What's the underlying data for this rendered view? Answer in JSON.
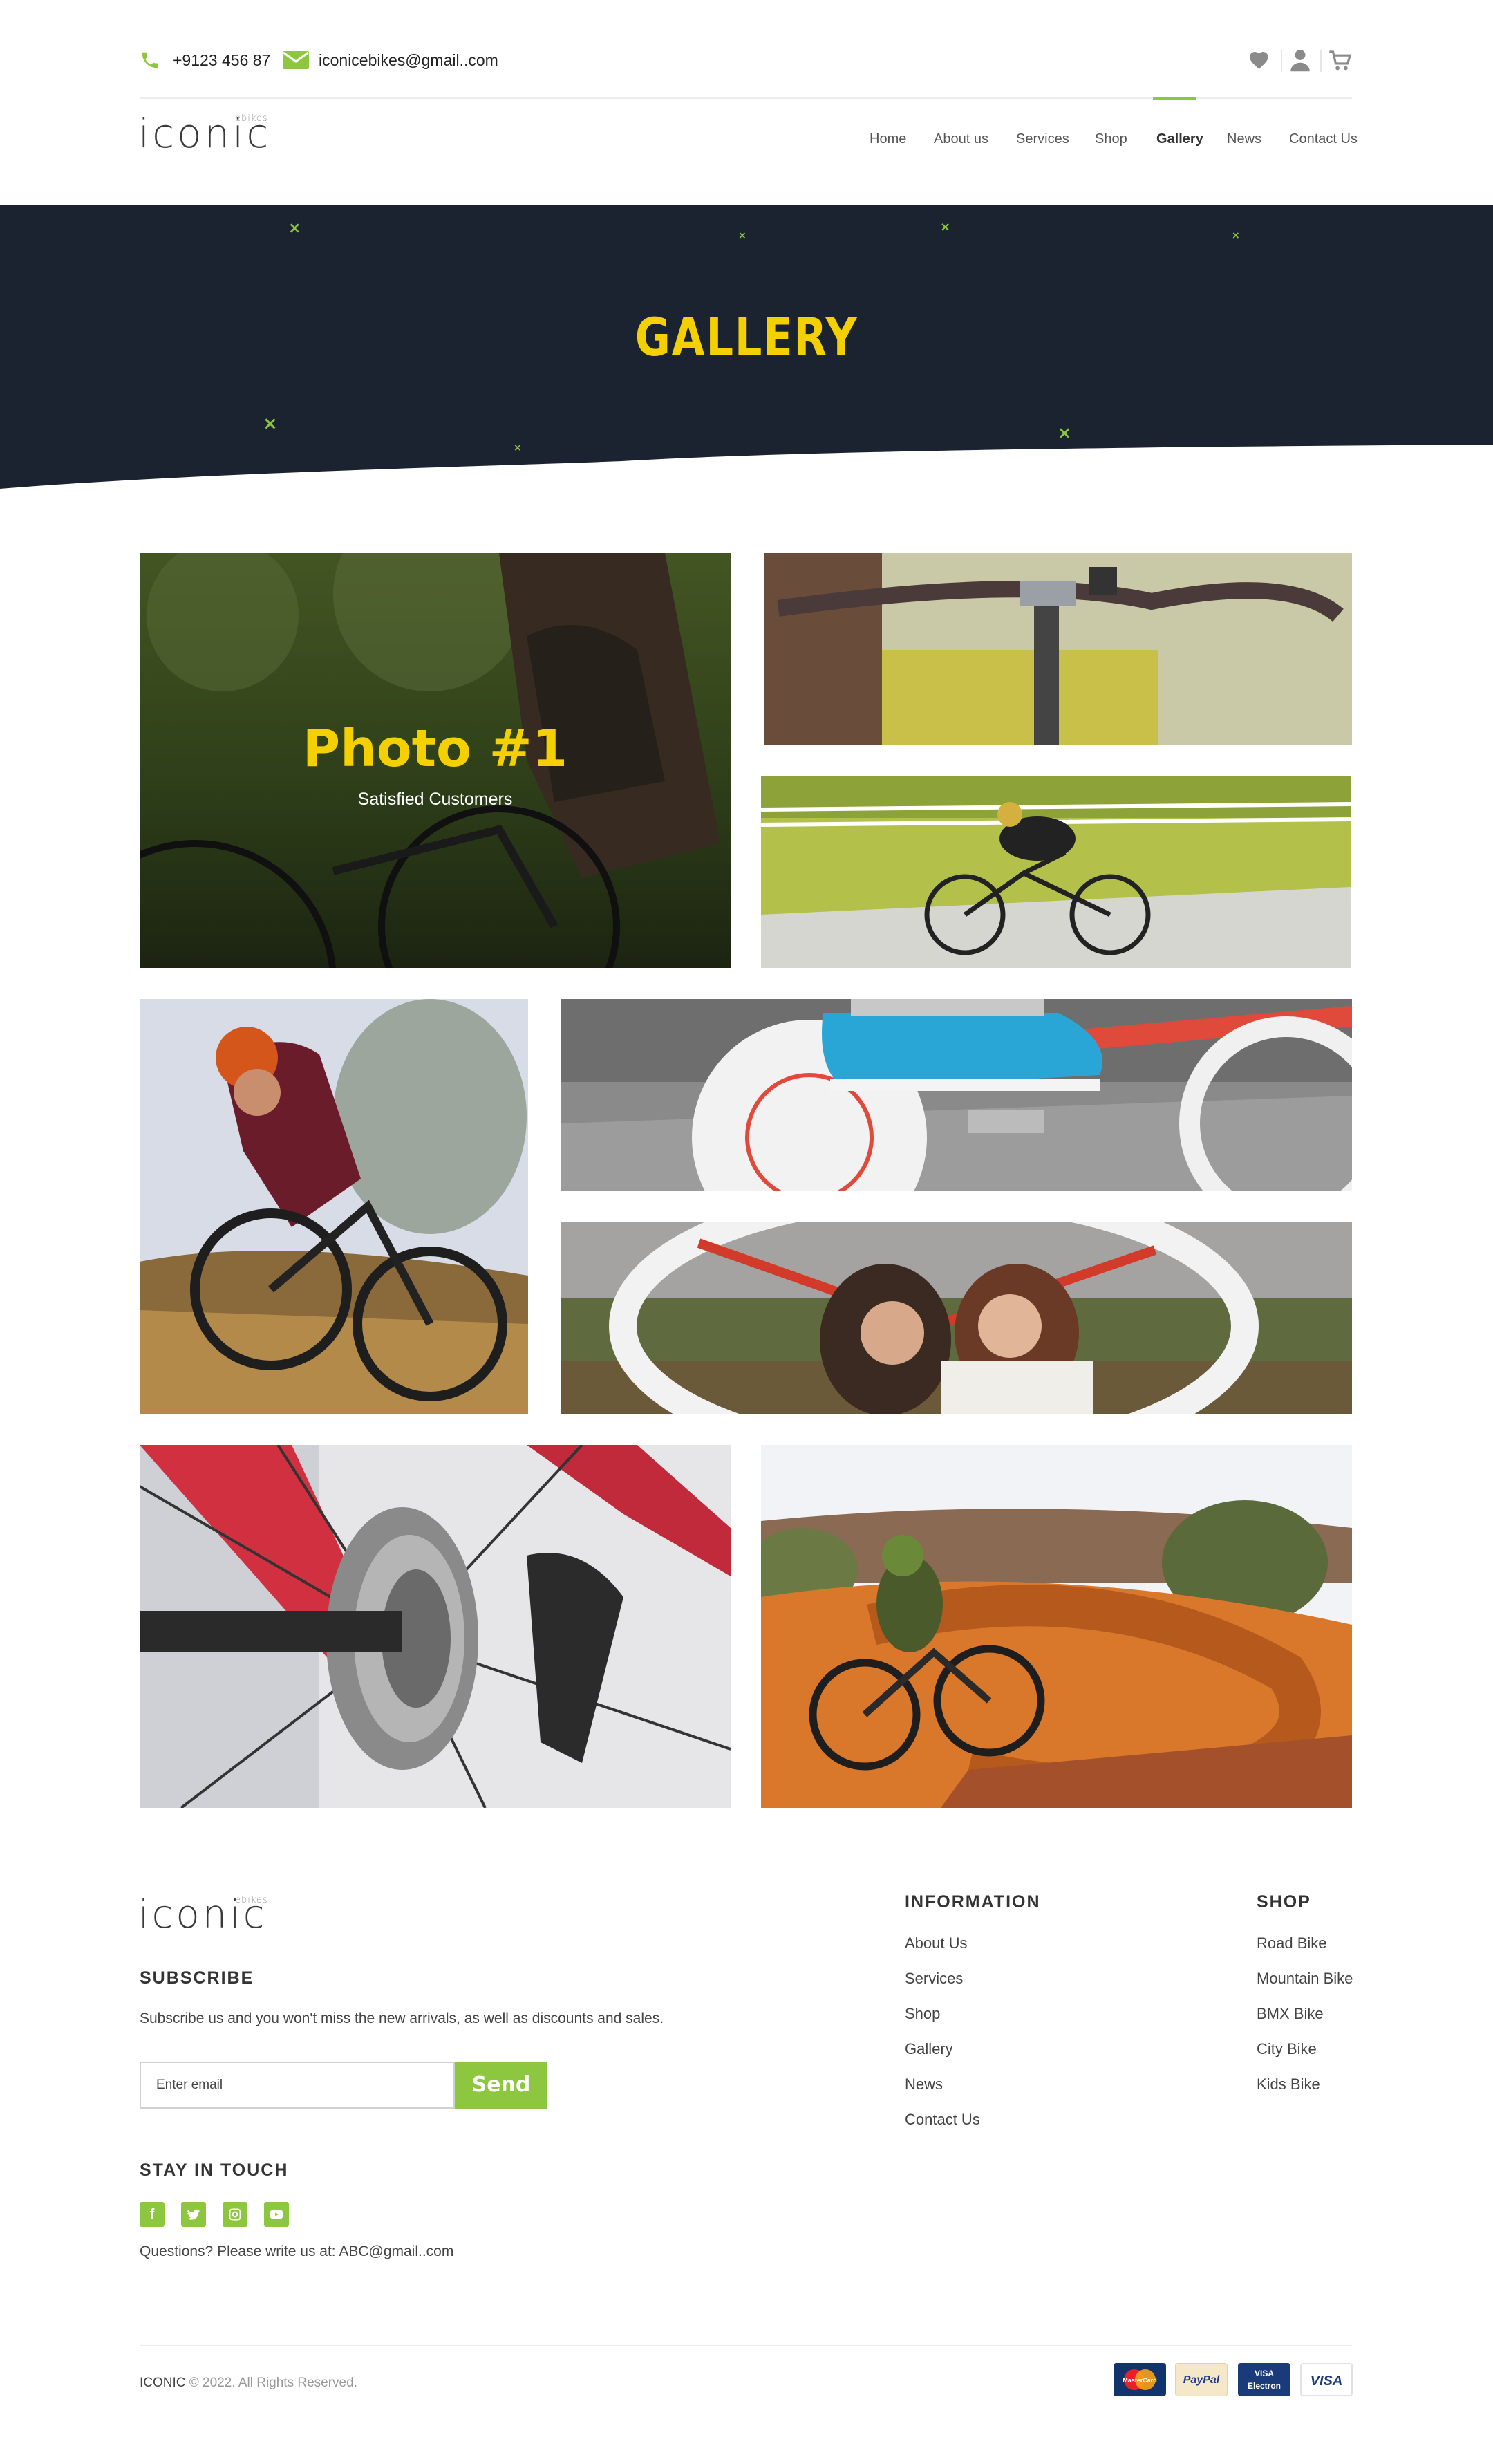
{
  "topbar": {
    "phone": "+9123 456 87",
    "email": "iconicebikes@gmail..com"
  },
  "brand": {
    "logo": "ICONIC",
    "logo_sup": "ebikes"
  },
  "nav": {
    "items": [
      "Home",
      "About us",
      "Services",
      "Shop",
      "Gallery",
      "News",
      "Contact Us"
    ],
    "active": "Gallery"
  },
  "hero": {
    "title": "GALLERY"
  },
  "gallery": {
    "featured_title": "Photo #1",
    "featured_subtitle": "Satisfied Customers"
  },
  "footer": {
    "subscribe_heading": "SUBSCRIBE",
    "subscribe_text": "Subscribe us and you won't miss the new arrivals, as well as discounts and sales.",
    "email_placeholder": "Enter email",
    "send_label": "Send",
    "stay_heading": "STAY IN TOUCH",
    "questions": "Questions? Please write us at: ABC@gmail..com",
    "info_heading": "INFORMATION",
    "info_links": [
      "About Us",
      "Services",
      "Shop",
      "Gallery",
      "News",
      "Contact Us"
    ],
    "shop_heading": "SHOP",
    "shop_links": [
      "Road Bike",
      "Mountain Bike",
      "BMX Bike",
      "City Bike",
      "Kids Bike"
    ],
    "copyright_brand": "ICONIC",
    "copyright_rest": "© 2022. All Rights Reserved.",
    "payments": [
      "MasterCard",
      "PayPal",
      "VISA Electron",
      "VISA"
    ]
  },
  "colors": {
    "accent_green": "#8dc63f",
    "hero_yellow": "#f5d000",
    "hero_dark": "#1c2330"
  },
  "icons": [
    "phone-icon",
    "mail-icon",
    "heart-icon",
    "user-icon",
    "cart-icon",
    "facebook-icon",
    "twitter-icon",
    "instagram-icon",
    "youtube-icon"
  ]
}
